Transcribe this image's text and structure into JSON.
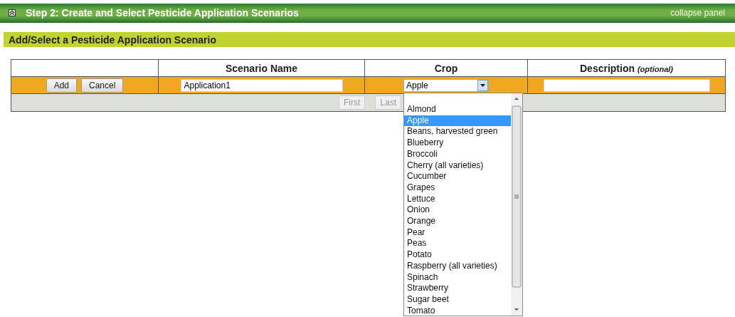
{
  "panel": {
    "title": "Step 2: Create and Select Pesticide Application Scenarios",
    "collapse_link": "collapse panel"
  },
  "section": {
    "title": "Add/Select a Pesticide Application Scenario"
  },
  "table": {
    "columns": [
      {},
      {
        "label": "Scenario Name"
      },
      {
        "label": "Crop"
      },
      {
        "label": "Description",
        "note": "(optional)"
      }
    ],
    "edit_row": {
      "buttons": [
        "Add",
        "Cancel"
      ],
      "scenario_name": "Application1",
      "crop": "Apple"
    },
    "pager": [
      "First",
      "Last"
    ]
  },
  "crop_dropdown": {
    "options": [
      {
        "label": "Almond",
        "selected": false
      },
      {
        "label": "Apple",
        "selected": true
      },
      {
        "label": "Beans, harvested green",
        "selected": false
      },
      {
        "label": "Blueberry",
        "selected": false
      },
      {
        "label": "Broccoli",
        "selected": false
      },
      {
        "label": "Cherry (all varieties)",
        "selected": false
      },
      {
        "label": "Cucumber",
        "selected": false
      },
      {
        "label": "Grapes",
        "selected": false
      },
      {
        "label": "Lettuce",
        "selected": false
      },
      {
        "label": "Onion",
        "selected": false
      },
      {
        "label": "Orange",
        "selected": false
      },
      {
        "label": "Pear",
        "selected": false
      },
      {
        "label": "Peas",
        "selected": false
      },
      {
        "label": "Potato",
        "selected": false
      },
      {
        "label": "Raspberry (all varieties)",
        "selected": false
      },
      {
        "label": "Spinach",
        "selected": false
      },
      {
        "label": "Strawberry",
        "selected": false
      },
      {
        "label": "Sugar beet",
        "selected": false
      },
      {
        "label": "Tomato",
        "selected": false
      }
    ]
  }
}
